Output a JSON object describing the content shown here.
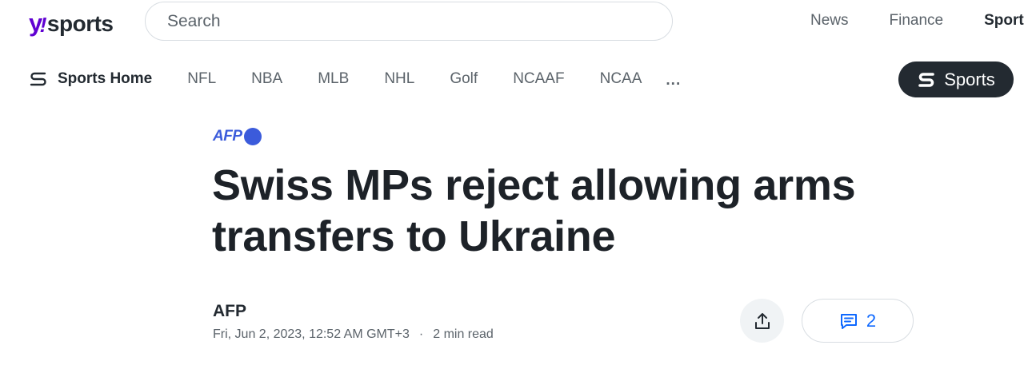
{
  "brand": {
    "y": "y",
    "bang": "!",
    "word": "sports"
  },
  "search": {
    "placeholder": "Search"
  },
  "top_nav": [
    {
      "label": "News"
    },
    {
      "label": "Finance"
    },
    {
      "label": "Sports"
    }
  ],
  "sub_nav": {
    "home_label": "Sports Home",
    "items": [
      {
        "label": "NFL"
      },
      {
        "label": "NBA"
      },
      {
        "label": "MLB"
      },
      {
        "label": "NHL"
      },
      {
        "label": "Golf"
      },
      {
        "label": "NCAAF"
      },
      {
        "label": "NCAA"
      }
    ],
    "more_label": "..."
  },
  "sports_pill": {
    "label": "Sports"
  },
  "article": {
    "source_logo": "AFP",
    "title": "Swiss MPs reject allowing arms transfers to Ukraine",
    "author": "AFP",
    "date": "Fri, Jun 2, 2023, 12:52 AM GMT+3",
    "separator": "·",
    "read_time": "2 min read",
    "comment_count": "2"
  },
  "colors": {
    "brand_purple": "#6001d2",
    "afp_blue": "#3b5bdb",
    "link_blue": "#0f69ff",
    "dark": "#232a31"
  },
  "icons": {
    "sports_mark": "sports-s-icon",
    "share": "share-icon",
    "comment": "comment-icon"
  }
}
